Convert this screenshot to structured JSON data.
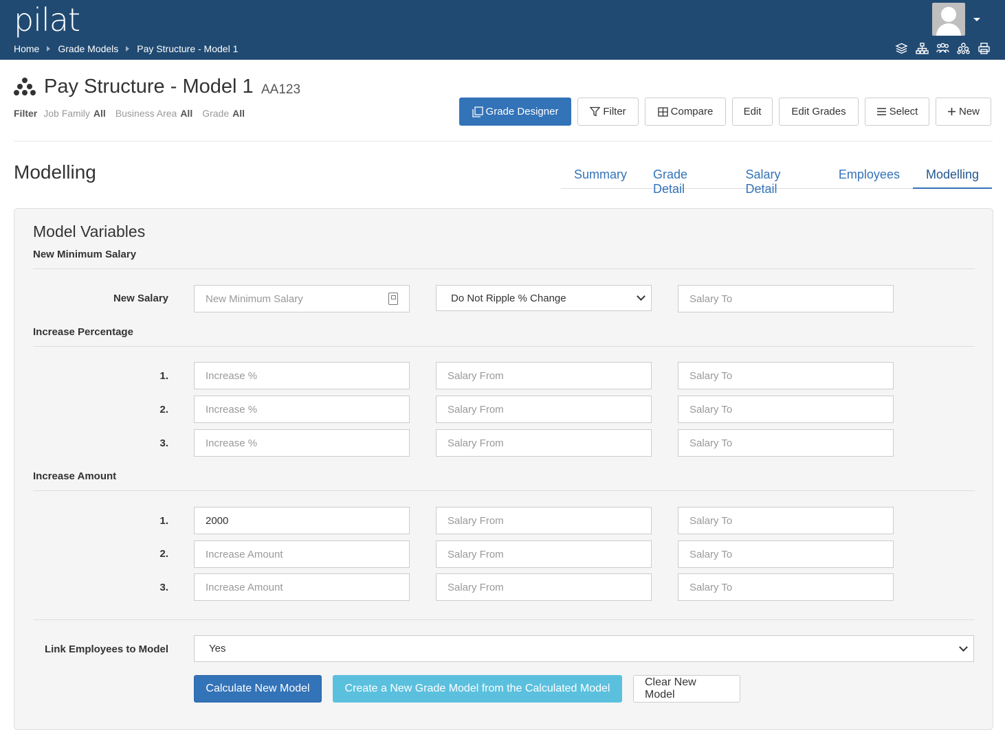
{
  "app": {
    "logo": "pilat"
  },
  "breadcrumb": [
    "Home",
    "Grade Models",
    "Pay Structure - Model 1"
  ],
  "header_icons": [
    "layers-icon",
    "org-chart-icon",
    "people-icon",
    "hierarchy-icon",
    "print-icon"
  ],
  "page": {
    "title": "Pay Structure - Model 1",
    "code": "AA123",
    "filter_label": "Filter",
    "filters": [
      {
        "key": "Job Family",
        "value": "All"
      },
      {
        "key": "Business Area",
        "value": "All"
      },
      {
        "key": "Grade",
        "value": "All"
      }
    ]
  },
  "actions": {
    "grade_designer": "Grade Designer",
    "filter": "Filter",
    "compare": "Compare",
    "edit": "Edit",
    "edit_grades": "Edit Grades",
    "select": "Select",
    "new": "New"
  },
  "section": {
    "title": "Modelling"
  },
  "tabs": [
    "Summary",
    "Grade Detail",
    "Salary Detail",
    "Employees",
    "Modelling"
  ],
  "active_tab": "Modelling",
  "model": {
    "title": "Model Variables",
    "new_min": {
      "heading": "New Minimum Salary",
      "row_label": "New Salary",
      "salary_placeholder": "New Minimum Salary",
      "ripple_option": "Do Not Ripple % Change",
      "salary_to": "Salary To"
    },
    "increase_pct": {
      "heading": "Increase Percentage",
      "rows": [
        {
          "num": "1.",
          "value": "",
          "placeholder": "Increase %",
          "from": "Salary From",
          "to": "Salary To"
        },
        {
          "num": "2.",
          "value": "",
          "placeholder": "Increase %",
          "from": "Salary From",
          "to": "Salary To"
        },
        {
          "num": "3.",
          "value": "",
          "placeholder": "Increase %",
          "from": "Salary From",
          "to": "Salary To"
        }
      ]
    },
    "increase_amt": {
      "heading": "Increase Amount",
      "rows": [
        {
          "num": "1.",
          "value": "2000",
          "placeholder": "Increase Amount",
          "from": "Salary From",
          "to": "Salary To"
        },
        {
          "num": "2.",
          "value": "",
          "placeholder": "Increase Amount",
          "from": "Salary From",
          "to": "Salary To"
        },
        {
          "num": "3.",
          "value": "",
          "placeholder": "Increase Amount",
          "from": "Salary From",
          "to": "Salary To"
        }
      ]
    },
    "link": {
      "label": "Link Employees to Model",
      "value": "Yes"
    },
    "buttons": {
      "calculate": "Calculate New Model",
      "create": "Create a New Grade Model from the Calculated Model",
      "clear": "Clear New Model"
    }
  },
  "colors": {
    "header": "#204a72",
    "primary": "#3373b8",
    "info": "#5bc0de"
  }
}
